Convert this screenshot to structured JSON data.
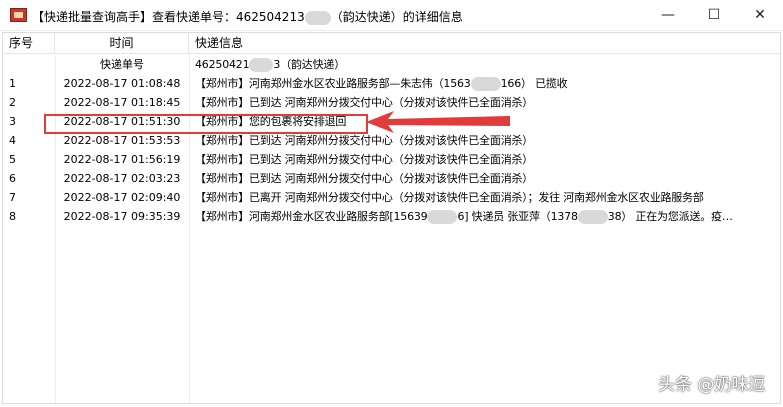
{
  "window": {
    "title": "【快递批量查询高手】查看快递单号：46250421317【/】(韵达快递）的详细信息",
    "title_display": "【快递批量查询高手】查看快递单号：462504213",
    "title_suffix": "（韵达快递）的详细信息",
    "minimize_glyph": "—",
    "maximize_glyph": "☐",
    "close_glyph": "✕"
  },
  "table": {
    "columns": [
      "序号",
      "时间",
      "快递信息"
    ],
    "subheader": {
      "label": "快递单号",
      "value_prefix": "46250421",
      "value_suffix": "3（韵达快递）"
    },
    "rows": [
      {
        "seq": "1",
        "time": "2022-08-17 01:08:48",
        "info_a": "【郑州市】河南郑州金水区农业路服务部—朱志伟（1563",
        "info_b": "166）  已揽收"
      },
      {
        "seq": "2",
        "time": "2022-08-17 01:18:45",
        "info_a": "【郑州市】已到达 河南郑州分拨交付中心（分拨对该快件已全面消杀）",
        "info_b": ""
      },
      {
        "seq": "3",
        "time": "2022-08-17 01:51:30",
        "info_a": "【郑州市】您的包裹将安排退回",
        "info_b": ""
      },
      {
        "seq": "4",
        "time": "2022-08-17 01:53:53",
        "info_a": "【郑州市】已到达 河南郑州分拨交付中心（分拨对该快件已全面消杀）",
        "info_b": ""
      },
      {
        "seq": "5",
        "time": "2022-08-17 01:56:19",
        "info_a": "【郑州市】已到达 河南郑州分拨交付中心（分拨对该快件已全面消杀）",
        "info_b": ""
      },
      {
        "seq": "6",
        "time": "2022-08-17 02:03:23",
        "info_a": "【郑州市】已到达 河南郑州分拨交付中心（分拨对该快件已全面消杀）",
        "info_b": ""
      },
      {
        "seq": "7",
        "time": "2022-08-17 02:09:40",
        "info_a": "【郑州市】已离开 河南郑州分拨交付中心（分拨对该快件已全面消杀）；发往 河南郑州金水区农业路服务部",
        "info_b": ""
      },
      {
        "seq": "8",
        "time": "2022-08-17 09:35:39",
        "info_a": "【郑州市】河南郑州金水区农业路服务部[15639",
        "info_b": "6] 快递员 张亚萍（1378",
        "info_c": "38） 正在为您派送。疫…"
      }
    ]
  },
  "annotation": {
    "highlight_color": "#e23b3b",
    "highlighted_row": "3"
  },
  "watermark": "头条 @奶味逗",
  "icons": {
    "app": "app-logo-icon"
  }
}
